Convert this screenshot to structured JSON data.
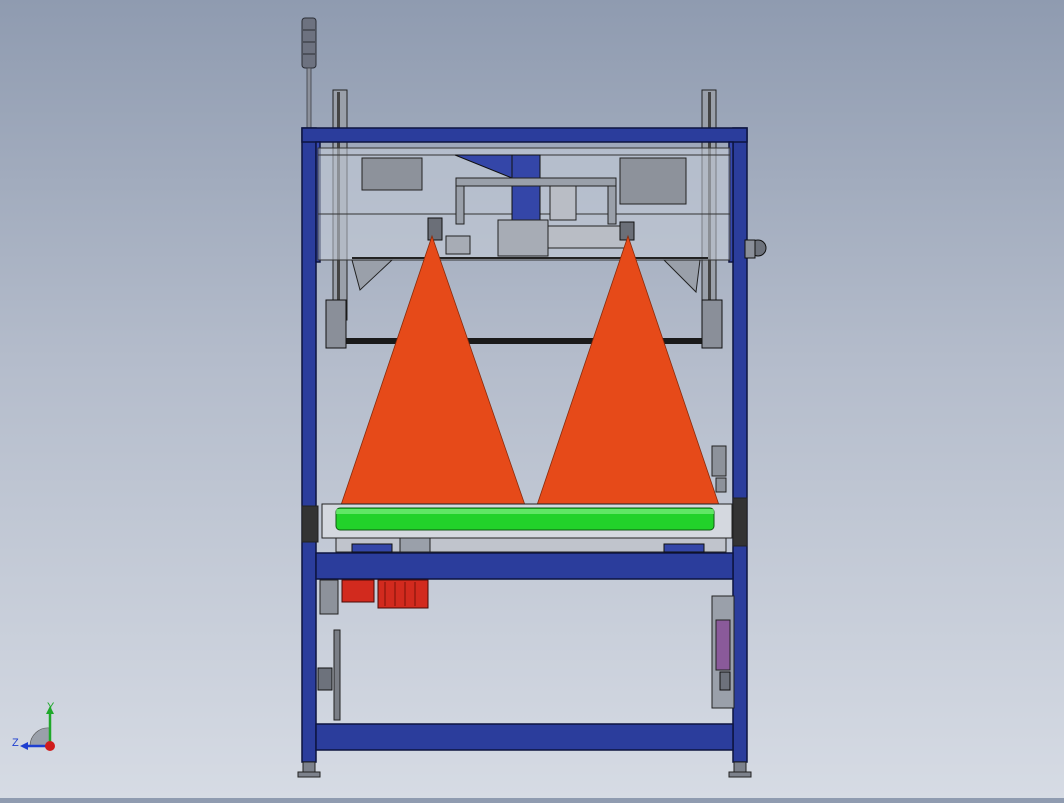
{
  "viewport": {
    "background_top": "#8f9bb0",
    "background_bottom": "#d6dbe4"
  },
  "model": {
    "frame_color": "#2b3d9c",
    "frame_edge_color": "#0d1440",
    "laser_color": "#e64a19",
    "roller_color": "#22d22a",
    "motor_color": "#d22a1e",
    "glass_color": "#c7cdd8"
  },
  "triad": {
    "y_label": "Y",
    "z_label": "Z",
    "x_color": "#d01c1c",
    "y_color": "#1fa82a",
    "z_color": "#1f3fd0",
    "icons": [
      "axis-triad-icon"
    ]
  }
}
